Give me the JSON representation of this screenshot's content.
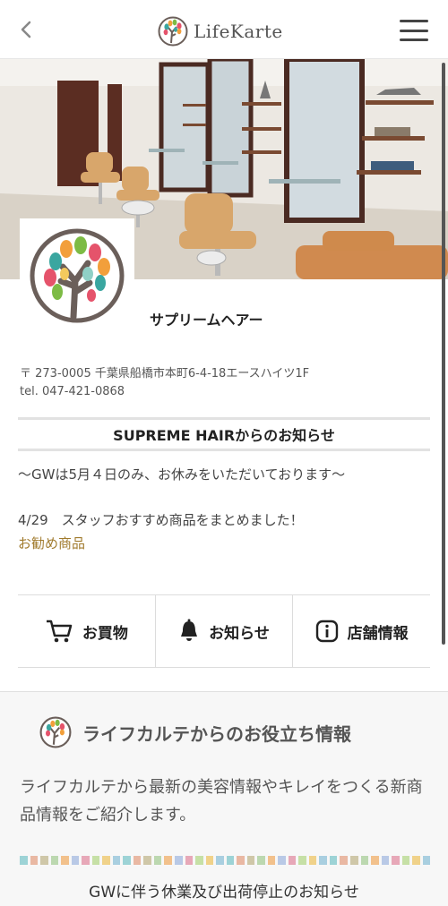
{
  "header": {
    "back_icon": "chevron-left-icon",
    "logo_text": "LifeKarte",
    "menu_icon": "hamburger-menu-icon"
  },
  "hero": {
    "image": "salon-interior-photo"
  },
  "shop": {
    "name": "サプリームヘアー",
    "address": "〒 273-0005 千葉県船橋市本町6-4-18エースハイツ1F",
    "tel": "tel. 047-421-0868"
  },
  "notice": {
    "title": "SUPREME HAIRからのお知らせ",
    "line1": "～GWは5月４日のみ、お休みをいただいております～",
    "line2": "4/29　スタッフおすすめ商品をまとめました！",
    "link": "お勧め商品"
  },
  "nav": [
    {
      "label": "お買物",
      "icon": "cart-icon"
    },
    {
      "label": "お知らせ",
      "icon": "bell-icon"
    },
    {
      "label": "店舗情報",
      "icon": "info-icon"
    }
  ],
  "info": {
    "title": "ライフカルテからのお役立ち情報",
    "description": "ライフカルテから最新の美容情報やキレイをつくる新商品情報をご紹介します。",
    "article_title": "GWに伴う休業及び出荷停止のお知らせ"
  },
  "colors": {
    "link": "#a07a2c",
    "stripe": [
      "#9dd3d6",
      "#e9b8a3",
      "#cfc7a8",
      "#bcd8b0",
      "#f2c18c",
      "#b9c9e6",
      "#e7a8b8",
      "#c6e0a6",
      "#f0d28a",
      "#a9cfe0"
    ]
  }
}
